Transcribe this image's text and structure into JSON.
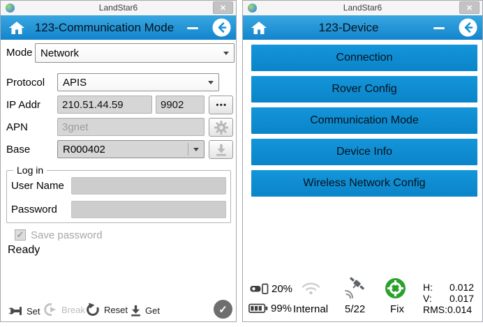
{
  "icons": {
    "close": "✕",
    "check": "✓",
    "more_dots": "•••"
  },
  "left_window": {
    "titlebar": {
      "app_title": "LandStar6"
    },
    "header": {
      "title": "123-Communication Mode"
    },
    "form": {
      "mode_label": "Mode",
      "mode_value": "Network",
      "protocol_label": "Protocol",
      "protocol_value": "APIS",
      "ip_label": "IP Addr",
      "ip_value": "210.51.44.59",
      "port_value": "9902",
      "apn_label": "APN",
      "apn_placeholder": "3gnet",
      "base_label": "Base",
      "base_value": "R000402",
      "login_legend": "Log in",
      "username_label": "User Name",
      "username_value": "",
      "password_label": "Password",
      "password_value": "",
      "save_password_label": "Save password",
      "save_password_checked": true,
      "status_text": "Ready"
    },
    "toolbar": {
      "set": "Set",
      "break": "Break",
      "reset": "Reset",
      "get": "Get"
    }
  },
  "right_window": {
    "titlebar": {
      "app_title": "LandStar6"
    },
    "header": {
      "title": "123-Device"
    },
    "menu_buttons": [
      "Connection",
      "Rover Config",
      "Communication Mode",
      "Device Info",
      "Wireless Network Config"
    ],
    "status": {
      "controller_battery": "20%",
      "receiver_battery": "99%",
      "datalink": "Internal",
      "satellites": "5/22",
      "solution": "Fix",
      "h_label": "H:",
      "h_value": "0.012",
      "v_label": "V:",
      "v_value": "0.017",
      "rms_label": "RMS:",
      "rms_value": "0.014"
    }
  },
  "colors": {
    "header_blue": "#1b93d5",
    "button_blue": "#0f8ed5",
    "fix_green": "#2aa12b",
    "accent": "#1590d6"
  }
}
